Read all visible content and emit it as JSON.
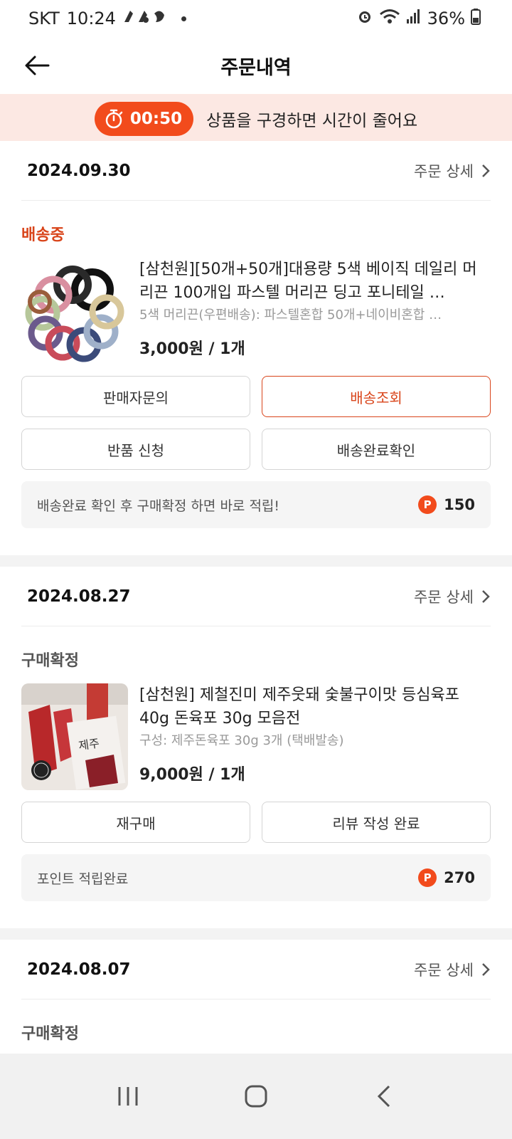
{
  "status_bar": {
    "carrier": "SKT",
    "time": "10:24",
    "battery": "36%"
  },
  "header": {
    "title": "주문내역"
  },
  "banner": {
    "timer": "00:50",
    "text": "상품을 구경하면 시간이 줄어요"
  },
  "orders": [
    {
      "date": "2024.09.30",
      "detail_label": "주문 상세",
      "status": "배송중",
      "product_name": "[삼천원][50개+50개]대용량 5색 베이직 데일리 머리끈 100개입 파스텔 머리끈 딩고 포니테일 …",
      "option": "5색 머리끈(우편배송): 파스텔혼합 50개+네이비혼합 …",
      "price": "3,000원 / 1개",
      "buttons": [
        "판매자문의",
        "배송조회",
        "반품 신청",
        "배송완료확인"
      ],
      "point_text": "배송완료 확인 후 구매확정 하면 바로 적립!",
      "point_value": "150"
    },
    {
      "date": "2024.08.27",
      "detail_label": "주문 상세",
      "status": "구매확정",
      "product_name": "[삼천원] 제철진미 제주웃돼 숯불구이맛 등심육포 40g 돈육포 30g 모음전",
      "option": "구성: 제주돈육포 30g 3개 (택배발송)",
      "price": "9,000원 / 1개",
      "buttons": [
        "재구매",
        "리뷰 작성 완료"
      ],
      "point_text": "포인트 적립완료",
      "point_value": "270"
    },
    {
      "date": "2024.08.07",
      "detail_label": "주문 상세",
      "status": "구매확정"
    }
  ],
  "icons": {
    "back": "arrow-left-icon",
    "timer": "stopwatch-icon",
    "chevron": "chevron-right-icon",
    "point": "point-p-icon"
  },
  "colors": {
    "accent": "#f24b1c",
    "status_shipping": "#d9451b",
    "banner_bg": "#fce8e3"
  },
  "point_glyph": "P"
}
